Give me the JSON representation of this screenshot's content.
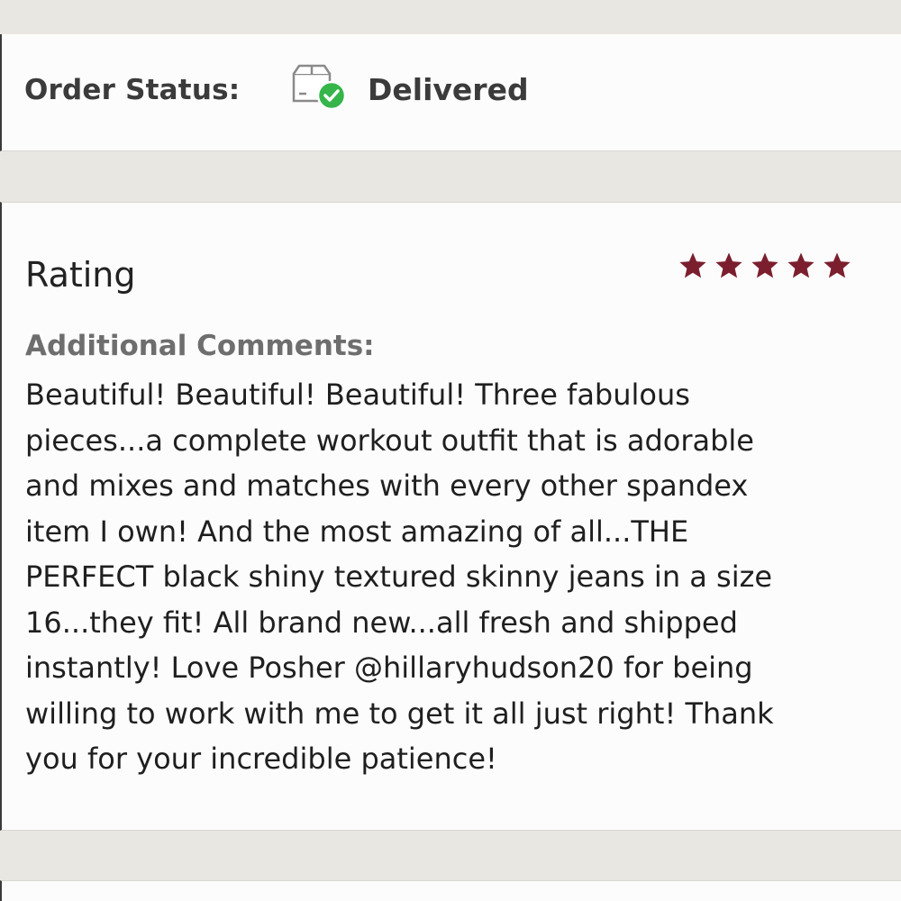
{
  "order_status": {
    "label": "Order Status:",
    "value": "Delivered",
    "icon": "package-delivered-icon",
    "check_color": "#35b54a"
  },
  "review": {
    "rating_title": "Rating",
    "rating_stars": 5,
    "rating_max": 5,
    "star_color": "#7b1f2e",
    "comments_label": "Additional Comments:",
    "comment_text": "Beautiful! Beautiful! Beautiful! Three fabulous\npieces...a complete workout outfit that is adorable\nand mixes and matches with every other spandex\nitem I own! And the most amazing of all...THE\nPERFECT black shiny textured skinny jeans in a size\n16...they fit! All brand new...all fresh and shipped\ninstantly! Love Posher @hillaryhudson20 for being\nwilling to work with me to get it all just right! Thank\nyou for your incredible patience!"
  }
}
